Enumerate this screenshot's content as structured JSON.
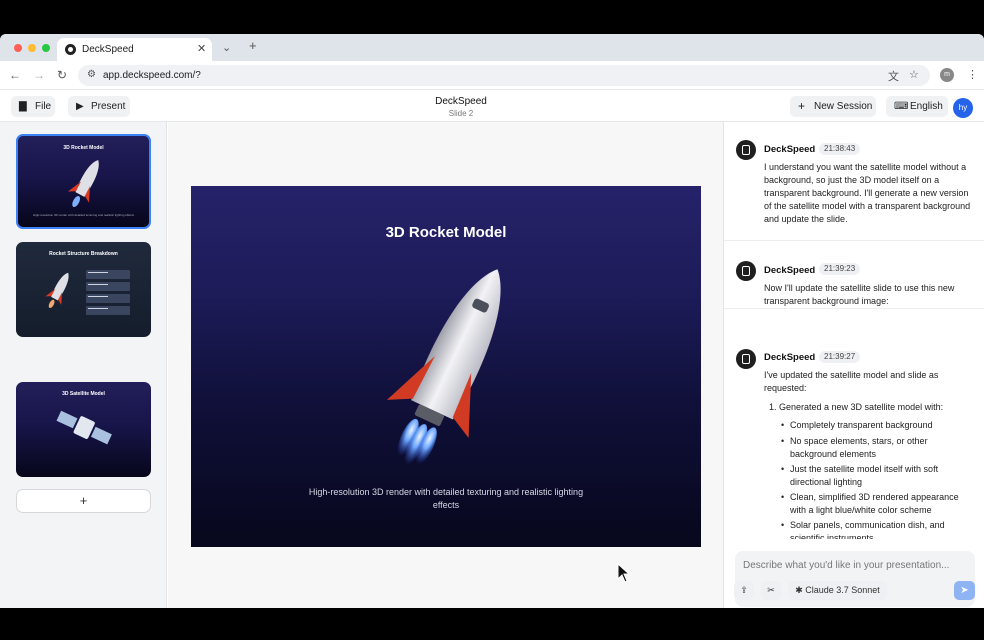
{
  "browser": {
    "tab_title": "DeckSpeed",
    "url": "app.deckspeed.com/?",
    "profile_initial": "m"
  },
  "header": {
    "file_label": "File",
    "present_label": "Present",
    "title": "DeckSpeed",
    "subtitle": "Slide 2",
    "new_session_label": "New Session",
    "language_label": "English",
    "user_initials": "hy"
  },
  "slides": [
    {
      "title": "3D Rocket Model",
      "caption": "High-resolution 3D render with detailed texturing and realistic lighting effects",
      "active": true
    },
    {
      "title": "Rocket Structure Breakdown",
      "caption": "",
      "active": false
    },
    {
      "title": "3D Satellite Model",
      "caption": "",
      "active": false
    }
  ],
  "add_slide_label": "+",
  "main_slide": {
    "title": "3D Rocket Model",
    "caption": "High-resolution 3D render with detailed texturing and realistic lighting effects"
  },
  "chat": {
    "messages": [
      {
        "author": "DeckSpeed",
        "time": "21:38:43",
        "text": "I understand you want the satellite model without a background, so just the 3D model itself on a transparent background. I'll generate a new version of the satellite model with a transparent background and update the slide."
      },
      {
        "author": "DeckSpeed",
        "time": "21:39:23",
        "text": "Now I'll update the satellite slide to use this new transparent background image:"
      },
      {
        "author": "DeckSpeed",
        "time": "21:39:27",
        "text": "I've updated the satellite model and slide as requested:",
        "list_item": "1. Generated a new 3D satellite model with:",
        "bullets": [
          "Completely transparent background",
          "No space elements, stars, or other background elements",
          "Just the satellite model itself with soft directional lighting",
          "Clean, simplified 3D rendered appearance with a light blue/white color scheme",
          "Solar panels, communication dish, and scientific instruments"
        ]
      }
    ],
    "composer_placeholder": "Describe what you'd like in your presentation...",
    "model_label": "Claude 3.7 Sonnet"
  }
}
